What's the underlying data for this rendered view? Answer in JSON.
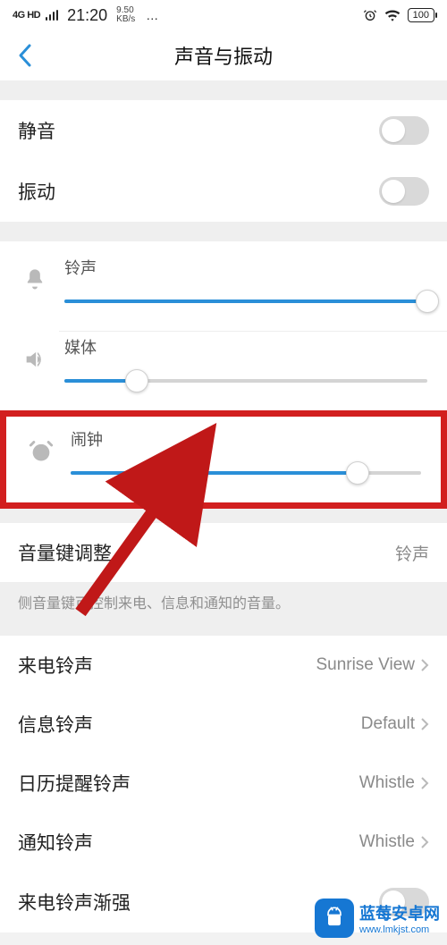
{
  "status_bar": {
    "signal_label": "4G HD",
    "time": "21:20",
    "kbs_top": "9.50",
    "kbs_bottom": "KB/s",
    "dots": "…",
    "battery": "100"
  },
  "header": {
    "title": "声音与振动"
  },
  "toggles": {
    "silent": {
      "label": "静音",
      "on": false
    },
    "vibrate": {
      "label": "振动",
      "on": false
    }
  },
  "sliders": {
    "ring": {
      "label": "铃声",
      "percent": 100
    },
    "media": {
      "label": "媒体",
      "percent": 20
    },
    "alarm": {
      "label": "闹钟",
      "percent": 82
    }
  },
  "volume_key": {
    "label": "音量键调整",
    "value": "铃声",
    "desc": "侧音量键可控制来电、信息和通知的音量。"
  },
  "sound_rows": {
    "incoming": {
      "label": "来电铃声",
      "value": "Sunrise View"
    },
    "message": {
      "label": "信息铃声",
      "value": "Default"
    },
    "calendar": {
      "label": "日历提醒铃声",
      "value": "Whistle"
    },
    "notify": {
      "label": "通知铃声",
      "value": "Whistle"
    },
    "ascend": {
      "label": "来电铃声渐强",
      "on": false
    }
  },
  "watermark": {
    "text": "蓝莓安卓网",
    "url": "www.lmkjst.com"
  },
  "colors": {
    "accent": "#2a8fd8",
    "highlight": "#d21f1f",
    "brand": "#1677d3"
  }
}
